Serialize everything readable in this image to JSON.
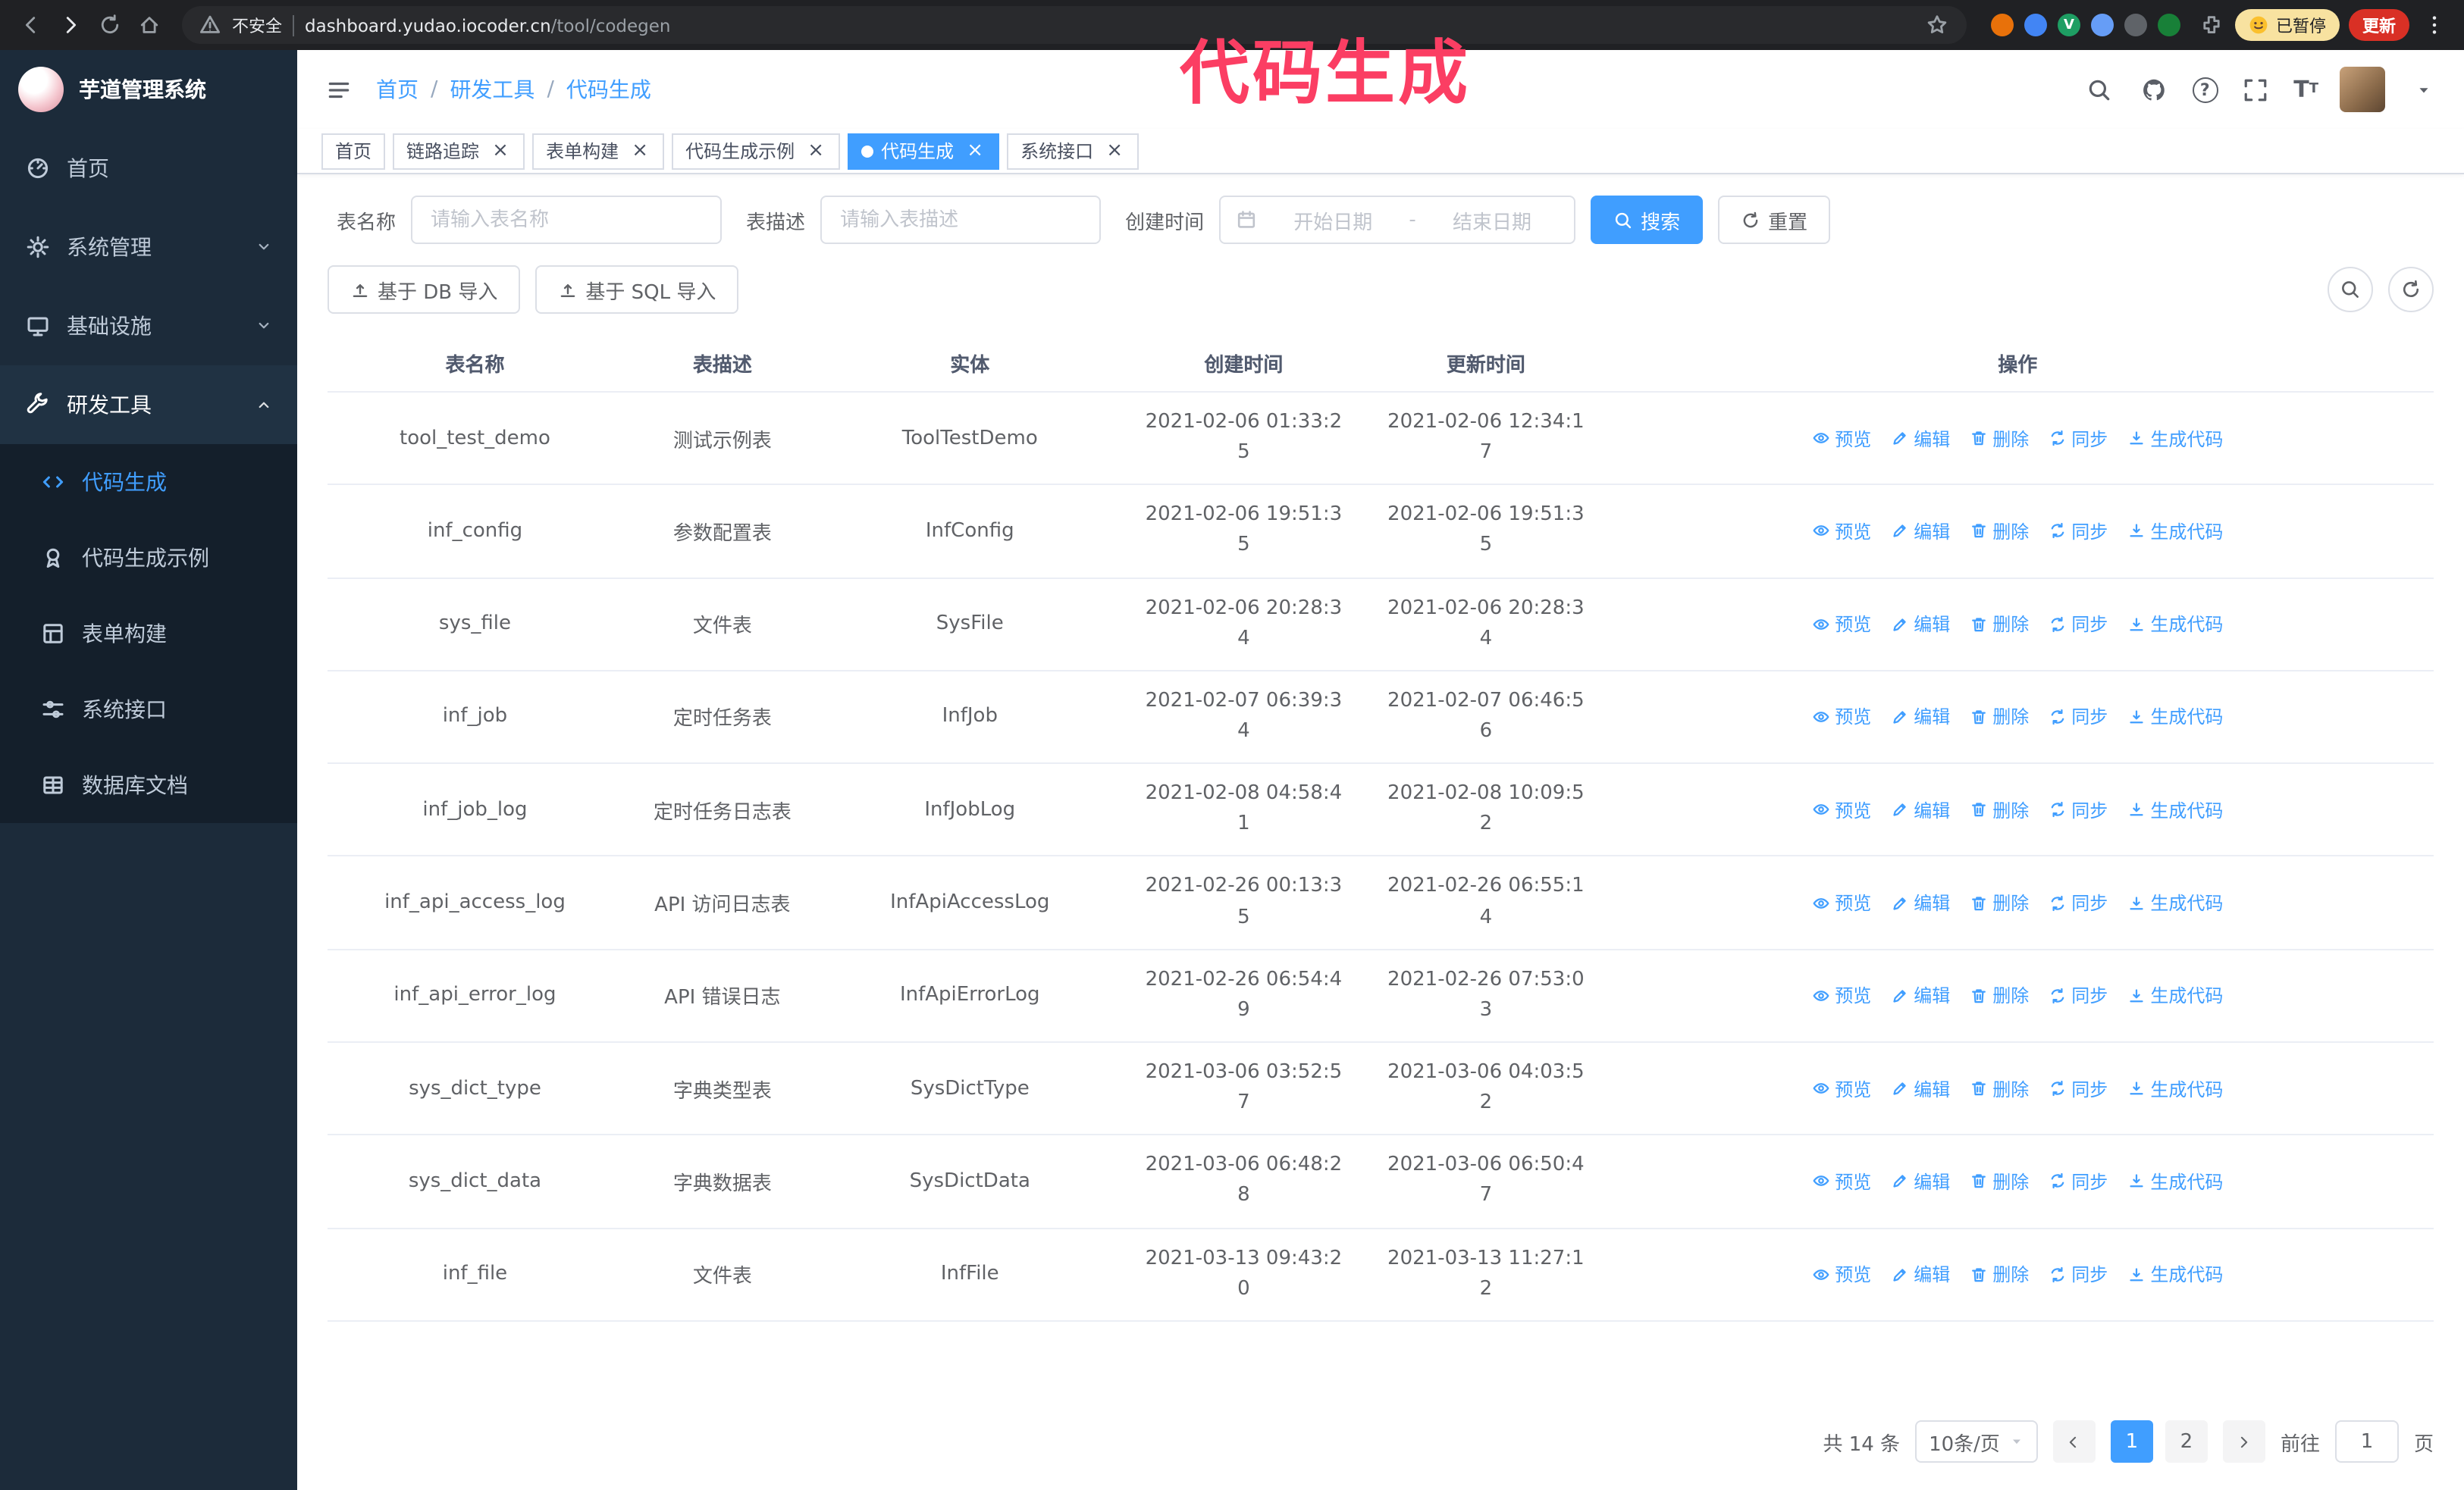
{
  "annotation": {
    "text": "代码生成",
    "color": "#fb3e63"
  },
  "browser": {
    "security_text": "不安全",
    "url_host": "dashboard.yudao.iocoder.cn",
    "url_path": "/tool/codegen",
    "extensions": [
      {
        "name": "extension-orange-icon",
        "color": "#e8710a",
        "letter": ""
      },
      {
        "name": "extension-blue-icon",
        "color": "#4285f4",
        "letter": ""
      },
      {
        "name": "extension-green-v-icon",
        "color": "#1e9e63",
        "letter": "V"
      },
      {
        "name": "extension-people-icon",
        "color": "#669df6",
        "letter": ""
      },
      {
        "name": "extension-dark-icon",
        "color": "#5f6368",
        "letter": ""
      },
      {
        "name": "extension-leaf-icon",
        "color": "#188038",
        "letter": ""
      }
    ],
    "paused_badge": "已暂停",
    "update_button": "更新"
  },
  "sidebar": {
    "logo_title": "芋道管理系统",
    "menu": [
      {
        "label": "首页",
        "icon": "dashboard",
        "chevron": "",
        "expanded": false
      },
      {
        "label": "系统管理",
        "icon": "gear",
        "chevron": "down",
        "expanded": false
      },
      {
        "label": "基础设施",
        "icon": "monitor",
        "chevron": "down",
        "expanded": false
      },
      {
        "label": "研发工具",
        "icon": "tool",
        "chevron": "up",
        "expanded": true
      }
    ],
    "submenu": [
      {
        "label": "代码生成",
        "icon": "code",
        "active": true
      },
      {
        "label": "代码生成示例",
        "icon": "medal",
        "active": false
      },
      {
        "label": "表单构建",
        "icon": "form",
        "active": false
      },
      {
        "label": "系统接口",
        "icon": "api",
        "active": false
      },
      {
        "label": "数据库文档",
        "icon": "grid",
        "active": false
      }
    ]
  },
  "header": {
    "breadcrumb": [
      "首页",
      "研发工具",
      "代码生成"
    ]
  },
  "tabs": [
    {
      "label": "首页",
      "closable": false,
      "active": false
    },
    {
      "label": "链路追踪",
      "closable": true,
      "active": false
    },
    {
      "label": "表单构建",
      "closable": true,
      "active": false
    },
    {
      "label": "代码生成示例",
      "closable": true,
      "active": false
    },
    {
      "label": "代码生成",
      "closable": true,
      "active": true
    },
    {
      "label": "系统接口",
      "closable": true,
      "active": false
    }
  ],
  "filters": {
    "table_name_label": "表名称",
    "table_name_placeholder": "请输入表名称",
    "table_desc_label": "表描述",
    "table_desc_placeholder": "请输入表描述",
    "create_time_label": "创建时间",
    "date_start_placeholder": "开始日期",
    "date_separator": "-",
    "date_end_placeholder": "结束日期",
    "search_button": "搜索",
    "reset_button": "重置"
  },
  "toolbar": {
    "import_db": "基于 DB 导入",
    "import_sql": "基于 SQL 导入"
  },
  "table": {
    "columns": [
      "表名称",
      "表描述",
      "实体",
      "创建时间",
      "更新时间",
      "操作"
    ],
    "actions": [
      {
        "key": "preview",
        "label": "预览",
        "icon": "eye"
      },
      {
        "key": "edit",
        "label": "编辑",
        "icon": "edit"
      },
      {
        "key": "delete",
        "label": "删除",
        "icon": "trash"
      },
      {
        "key": "sync",
        "label": "同步",
        "icon": "sync"
      },
      {
        "key": "generate-code",
        "label": "生成代码",
        "icon": "download"
      }
    ],
    "rows": [
      {
        "name": "tool_test_demo",
        "desc": "测试示例表",
        "entity": "ToolTestDemo",
        "created": "2021-02-06 01:33:25",
        "updated": "2021-02-06 12:34:17"
      },
      {
        "name": "inf_config",
        "desc": "参数配置表",
        "entity": "InfConfig",
        "created": "2021-02-06 19:51:35",
        "updated": "2021-02-06 19:51:35"
      },
      {
        "name": "sys_file",
        "desc": "文件表",
        "entity": "SysFile",
        "created": "2021-02-06 20:28:34",
        "updated": "2021-02-06 20:28:34"
      },
      {
        "name": "inf_job",
        "desc": "定时任务表",
        "entity": "InfJob",
        "created": "2021-02-07 06:39:34",
        "updated": "2021-02-07 06:46:56"
      },
      {
        "name": "inf_job_log",
        "desc": "定时任务日志表",
        "entity": "InfJobLog",
        "created": "2021-02-08 04:58:41",
        "updated": "2021-02-08 10:09:52"
      },
      {
        "name": "inf_api_access_log",
        "desc": "API 访问日志表",
        "entity": "InfApiAccessLog",
        "created": "2021-02-26 00:13:35",
        "updated": "2021-02-26 06:55:14"
      },
      {
        "name": "inf_api_error_log",
        "desc": "API 错误日志",
        "entity": "InfApiErrorLog",
        "created": "2021-02-26 06:54:49",
        "updated": "2021-02-26 07:53:03"
      },
      {
        "name": "sys_dict_type",
        "desc": "字典类型表",
        "entity": "SysDictType",
        "created": "2021-03-06 03:52:57",
        "updated": "2021-03-06 04:03:52"
      },
      {
        "name": "sys_dict_data",
        "desc": "字典数据表",
        "entity": "SysDictData",
        "created": "2021-03-06 06:48:28",
        "updated": "2021-03-06 06:50:47"
      },
      {
        "name": "inf_file",
        "desc": "文件表",
        "entity": "InfFile",
        "created": "2021-03-13 09:43:20",
        "updated": "2021-03-13 11:27:12"
      }
    ]
  },
  "pagination": {
    "total_text": "共 14 条",
    "page_size_text": "10条/页",
    "pages": [
      "1",
      "2"
    ],
    "active_page": "1",
    "goto_label": "前往",
    "goto_value": "1",
    "goto_unit": "页"
  },
  "colors": {
    "primary": "#409eff",
    "sidebar_bg": "#1c2b3a",
    "chrome_bg": "#202124",
    "annotation": "#fb3e63"
  }
}
